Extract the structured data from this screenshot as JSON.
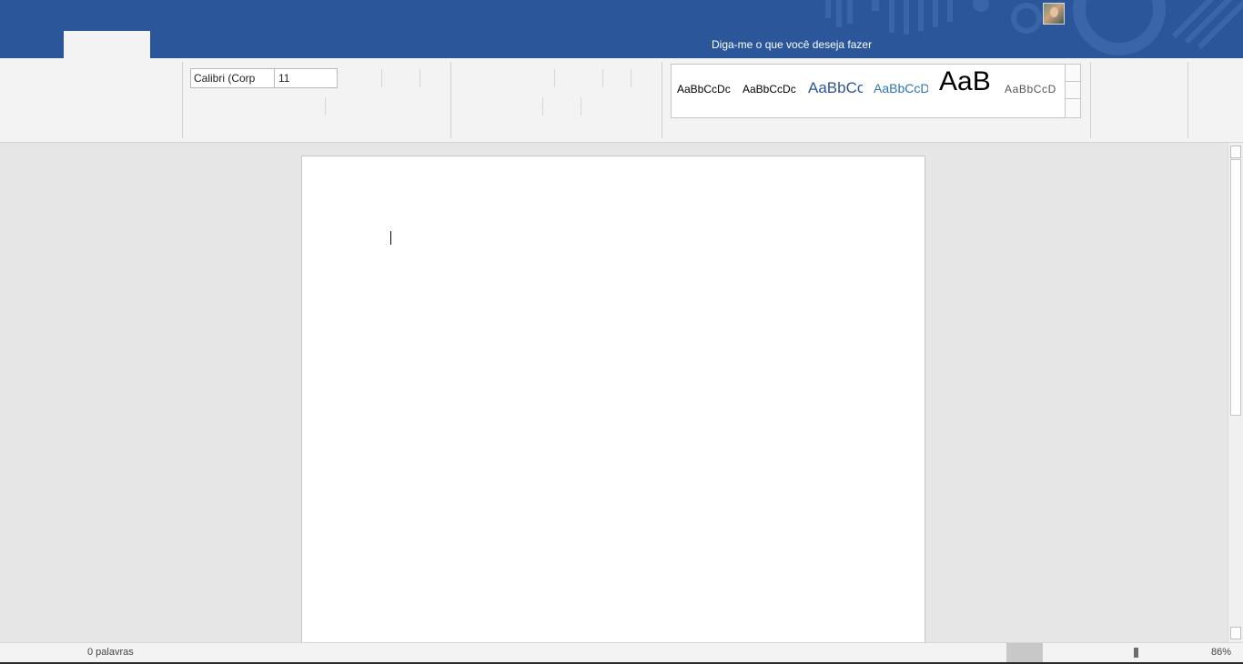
{
  "titlebar": {
    "tell_me": "Diga-me o que você deseja fazer",
    "color": "#2b579a"
  },
  "ribbon": {
    "font_name": "Calibri (Corp",
    "font_size": "11",
    "styles": [
      "AaBbCcDc",
      "AaBbCcDc",
      "AaBbCc",
      "AaBbCcD",
      "AaB",
      "AaBbCcD"
    ]
  },
  "statusbar": {
    "word_count": "0 palavras",
    "zoom": "86%"
  }
}
